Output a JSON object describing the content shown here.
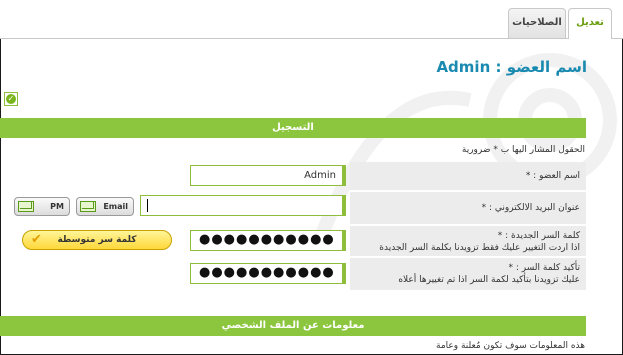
{
  "tabs": [
    {
      "label": "تعديل",
      "active": true
    },
    {
      "label": "الصلاحيات",
      "active": false
    }
  ],
  "title": "اسم العضو : Admin",
  "sections": {
    "registration": "التسجيل",
    "profile": "معلومات عن الملف الشخصي"
  },
  "required_note": "الحقول المشار اليها ب * ضرورية",
  "profile_note": "هذه المعلومات سوف تكون مُعلنة وعامة",
  "fields": {
    "username": {
      "label": "اسم العضو : *",
      "value": "Admin"
    },
    "email": {
      "label": "عنوان البريد الالكتروني : *",
      "value": ""
    },
    "new_password": {
      "label": "كلمة السر الجديدة : *",
      "hint": "اذا اردت التغيير عليك فقط تزويدنا بكلمة السر الجديدة",
      "value": "●●●●●●●●●●●"
    },
    "confirm_password": {
      "label": "تأكيد كلمة السر : *",
      "hint": "عليك تزويدنا بتأكيد لكمة السر اذا تم تغييرها أعلاه",
      "value": "●●●●●●●●●●●"
    }
  },
  "buttons": {
    "email": "Email",
    "pm": "PM"
  },
  "password_strength": "كلمة سر متوسطة",
  "colors": {
    "accent": "#8cc63f",
    "title": "#1a8ab0",
    "label_bg": "#ececec"
  }
}
